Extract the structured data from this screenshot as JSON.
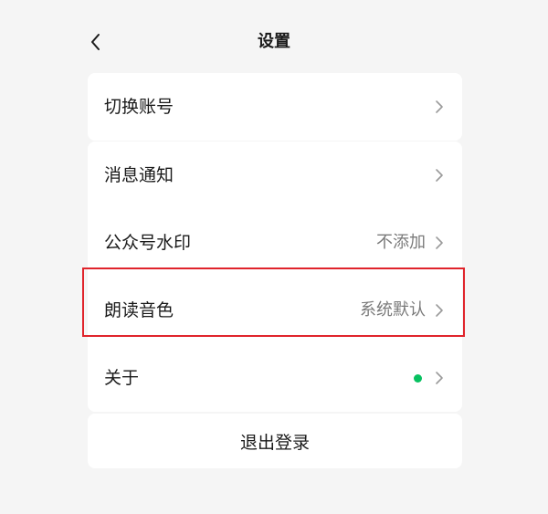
{
  "header": {
    "title": "设置",
    "back_icon": "chevron-left-icon"
  },
  "groups": [
    {
      "items": [
        {
          "label": "切换账号",
          "value": "",
          "icon": "chevron-right-icon"
        }
      ]
    },
    {
      "items": [
        {
          "label": "消息通知",
          "value": "",
          "icon": "chevron-right-icon"
        },
        {
          "label": "公众号水印",
          "value": "不添加",
          "icon": "chevron-right-icon"
        },
        {
          "label": "朗读音色",
          "value": "系统默认",
          "icon": "chevron-right-icon",
          "highlighted": true
        },
        {
          "label": "关于",
          "value": "",
          "indicator": "green-dot",
          "icon": "chevron-right-icon"
        }
      ]
    }
  ],
  "logout": {
    "label": "退出登录"
  },
  "colors": {
    "background": "#f5f5f5",
    "card": "#ffffff",
    "text": "#1a1a1a",
    "secondary_text": "#7a7a7a",
    "indicator_dot": "#07c160",
    "highlight_border": "#e0242b"
  }
}
